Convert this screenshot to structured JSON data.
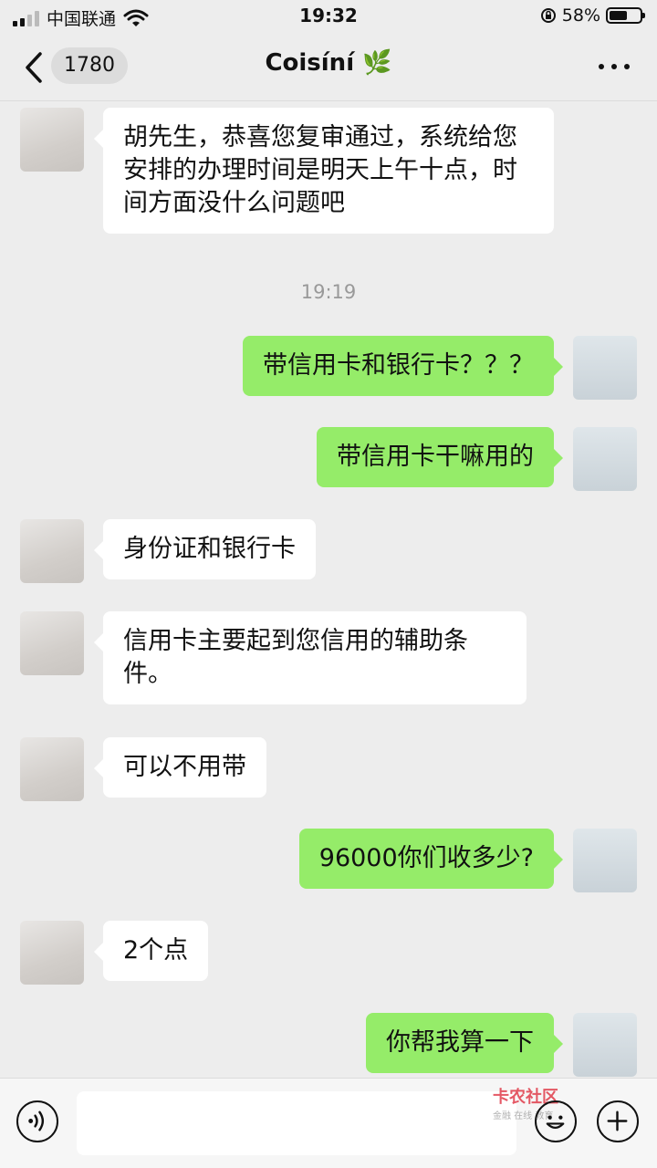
{
  "status_bar": {
    "carrier": "中国联通",
    "time": "19:32",
    "battery": "58%",
    "battery_level": 0.58
  },
  "nav": {
    "unread_count": "1780",
    "title": "Coisíní",
    "title_emoji": "🌿"
  },
  "messages": [
    {
      "side": "left",
      "text": "胡先生，恭喜您复审通过，系统给您安排的办理时间是明天上午十点，时间方面没什么问题吧"
    },
    {
      "type": "time",
      "text": "19:19"
    },
    {
      "side": "right",
      "text": "带信用卡和银行卡？？？"
    },
    {
      "side": "right",
      "text": "带信用卡干嘛用的"
    },
    {
      "side": "left",
      "text": "身份证和银行卡"
    },
    {
      "side": "left",
      "text": "信用卡主要起到您信用的辅助条件。"
    },
    {
      "side": "left",
      "text": "可以不用带"
    },
    {
      "side": "right",
      "text": "96000你们收多少?"
    },
    {
      "side": "left",
      "text": "2个点"
    },
    {
      "side": "right",
      "text": "你帮我算一下"
    }
  ],
  "watermark": {
    "name": "卡农社区",
    "tagline": "金融 在线 教育"
  },
  "icons": [
    "back-chevron-icon",
    "wifi-icon",
    "lock-rotation-icon",
    "battery-icon",
    "more-icon",
    "voice-icon",
    "emoji-icon",
    "plus-icon"
  ]
}
